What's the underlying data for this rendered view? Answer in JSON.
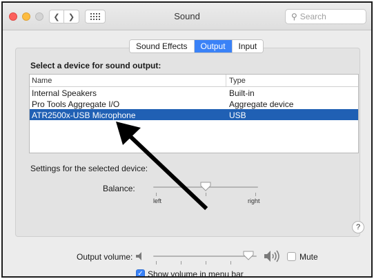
{
  "window": {
    "title": "Sound",
    "search_placeholder": "Search"
  },
  "tabs": [
    {
      "label": "Sound Effects",
      "active": false
    },
    {
      "label": "Output",
      "active": true
    },
    {
      "label": "Input",
      "active": false
    }
  ],
  "output": {
    "heading": "Select a device for sound output:",
    "columns": {
      "name": "Name",
      "type": "Type"
    },
    "devices": [
      {
        "name": "Internal Speakers",
        "type": "Built-in"
      },
      {
        "name": "Pro Tools Aggregate I/O",
        "type": "Aggregate device"
      },
      {
        "name": "ATR2500x-USB Microphone",
        "type": "USB"
      }
    ],
    "selected_index": 2,
    "settings_label": "Settings for the selected device:",
    "balance": {
      "label": "Balance:",
      "left_label": "left",
      "right_label": "right",
      "value": 0.5
    }
  },
  "help_label": "?",
  "volume": {
    "label": "Output volume:",
    "level": 0.92,
    "mute_label": "Mute",
    "muted": false,
    "show_in_menu_bar_label": "Show volume in menu bar",
    "show_in_menu_bar": true
  },
  "colors": {
    "selection": "#2060b4",
    "accent": "#3a82f7",
    "annotation_arrow": "#000000"
  }
}
